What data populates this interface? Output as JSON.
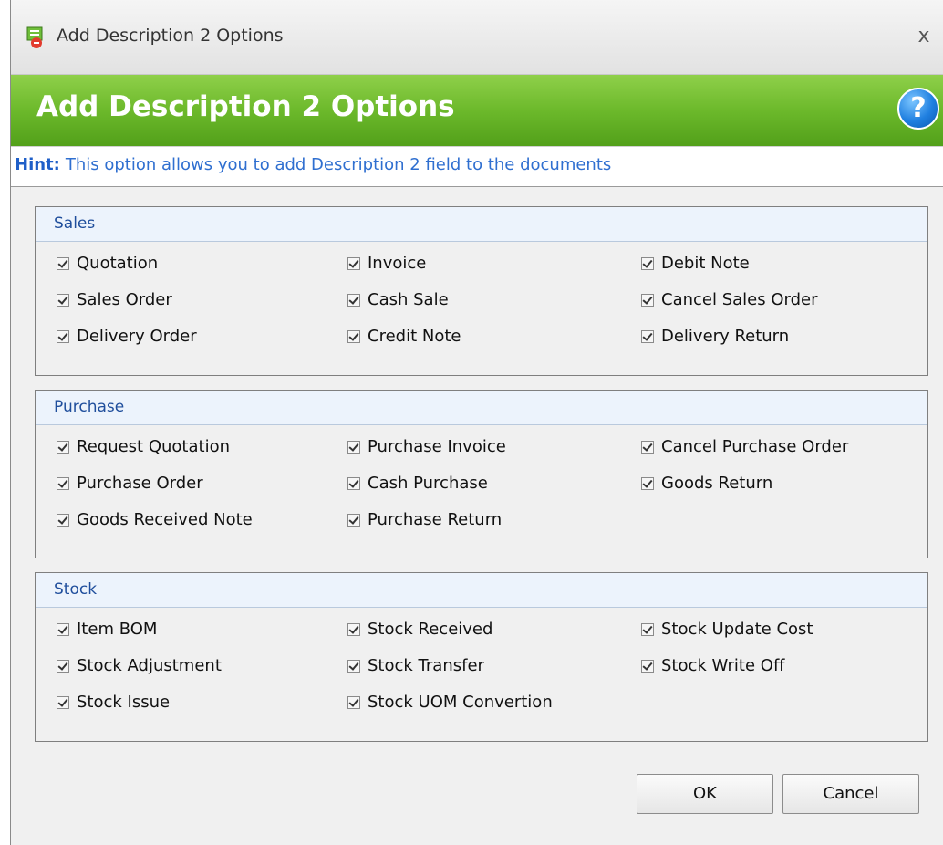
{
  "window": {
    "title": "Add Description 2 Options",
    "close_glyph": "x"
  },
  "banner": {
    "title": "Add Description 2 Options",
    "help_glyph": "?"
  },
  "hint": {
    "label": "Hint:",
    "text": "This option allows you to add Description 2 field to the documents"
  },
  "groups": [
    {
      "title": "Sales",
      "columns": [
        [
          "Quotation",
          "Sales Order",
          "Delivery Order"
        ],
        [
          "Invoice",
          "Cash Sale",
          "Credit Note"
        ],
        [
          "Debit Note",
          "Cancel Sales Order",
          "Delivery Return"
        ]
      ]
    },
    {
      "title": "Purchase",
      "columns": [
        [
          "Request Quotation",
          "Purchase Order",
          "Goods Received Note"
        ],
        [
          "Purchase Invoice",
          "Cash Purchase",
          "Purchase Return"
        ],
        [
          "Cancel Purchase Order",
          "Goods Return"
        ]
      ]
    },
    {
      "title": "Stock",
      "columns": [
        [
          "Item BOM",
          "Stock Adjustment",
          "Stock Issue"
        ],
        [
          "Stock Received",
          "Stock Transfer",
          "Stock UOM Convertion"
        ],
        [
          "Stock Update Cost",
          "Stock Write Off"
        ]
      ]
    }
  ],
  "buttons": {
    "ok": "OK",
    "cancel": "Cancel"
  },
  "colors": {
    "banner_green": "#6cb92b",
    "hint_blue": "#2f6fd0",
    "group_header_text": "#1f4e9c"
  }
}
